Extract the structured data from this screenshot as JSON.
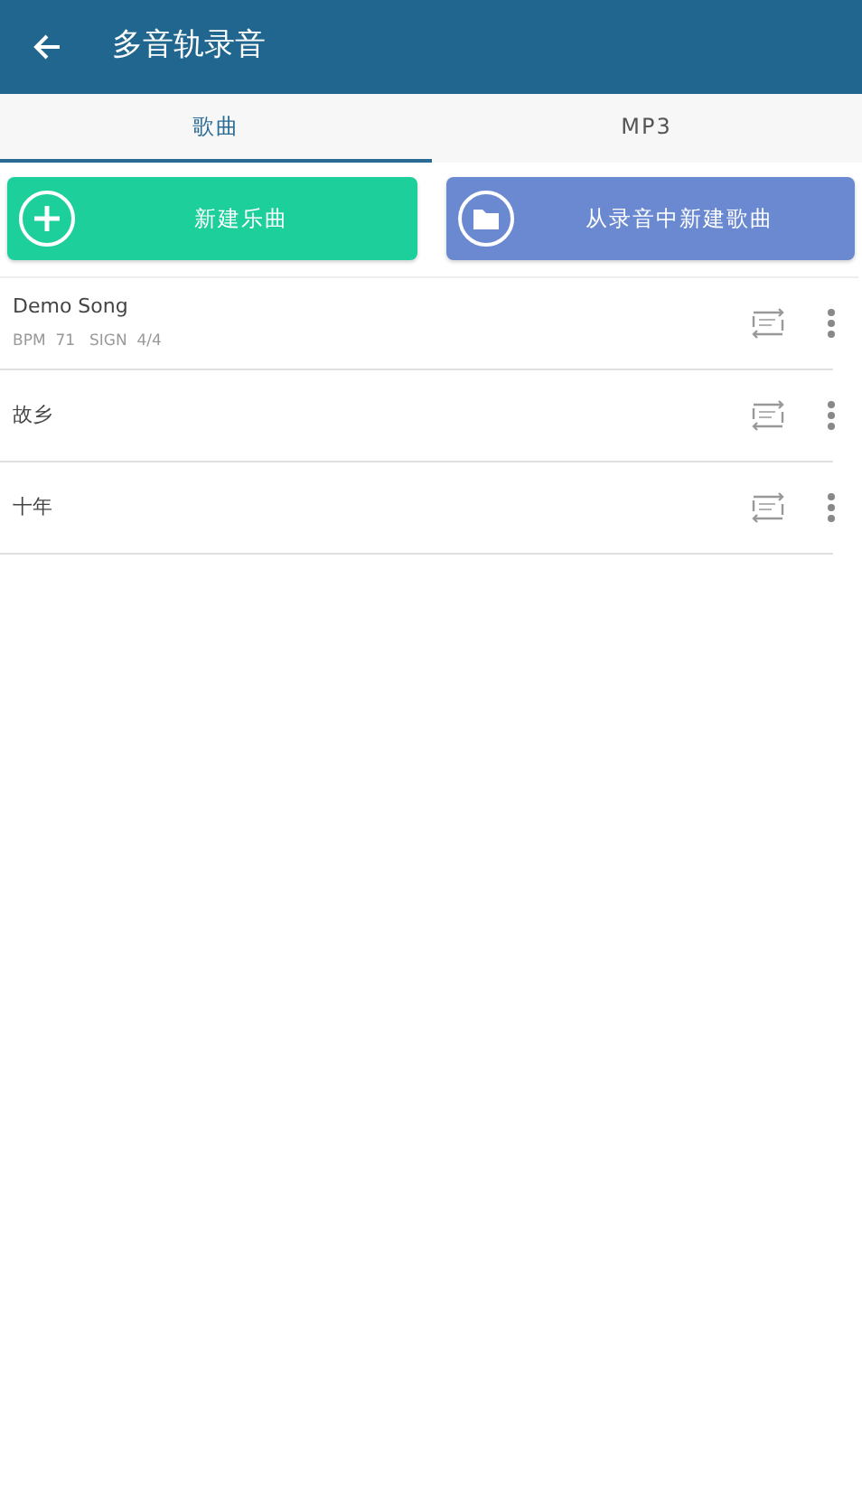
{
  "app_bar": {
    "title": "多音轨录音"
  },
  "tabs": [
    {
      "label": "歌曲",
      "selected": true
    },
    {
      "label": "MP3",
      "selected": false
    }
  ],
  "actions": [
    {
      "kind": "new",
      "label": "新建乐曲",
      "color": "#1dcf9a"
    },
    {
      "kind": "folder",
      "label": "从录音中新建歌曲",
      "color": "#6a89d0"
    }
  ],
  "songs": [
    {
      "title": "Demo Song",
      "meta": [
        "BPM  71",
        "SIGN  4/4"
      ]
    },
    {
      "title": "故乡"
    },
    {
      "title": "十年"
    }
  ]
}
